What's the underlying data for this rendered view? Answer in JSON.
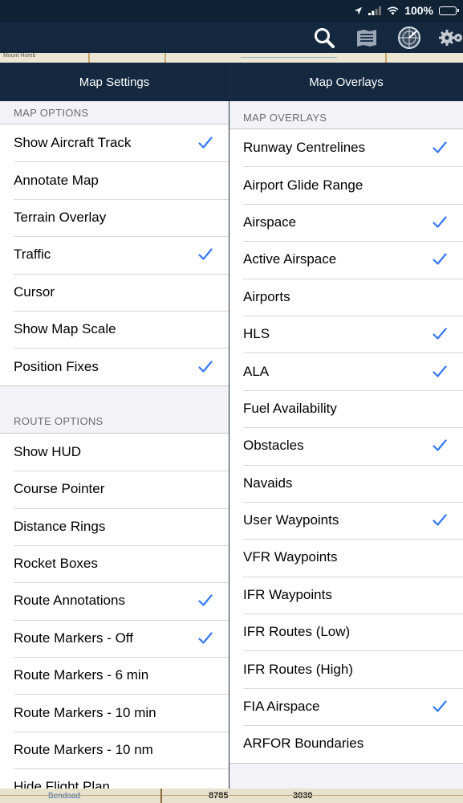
{
  "status": {
    "battery": "100%"
  },
  "toolbar": {
    "icons": [
      "search-icon",
      "list-icon",
      "radar-icon",
      "settings-icon"
    ]
  },
  "map": {
    "place_label": "Mount Horeb",
    "bottom_label_1": "Bendoad",
    "bottom_label_2": "8785",
    "bottom_label_3": "3030"
  },
  "left": {
    "title": "Map Settings",
    "section1": "MAP OPTIONS",
    "items1": [
      {
        "label": "Show Aircraft Track",
        "checked": true
      },
      {
        "label": "Annotate Map",
        "checked": false
      },
      {
        "label": "Terrain Overlay",
        "checked": false
      },
      {
        "label": "Traffic",
        "checked": true
      },
      {
        "label": "Cursor",
        "checked": false
      },
      {
        "label": "Show Map Scale",
        "checked": false
      },
      {
        "label": "Position Fixes",
        "checked": true
      }
    ],
    "section2": "ROUTE OPTIONS",
    "items2": [
      {
        "label": "Show HUD",
        "checked": false
      },
      {
        "label": "Course Pointer",
        "checked": false
      },
      {
        "label": "Distance Rings",
        "checked": false
      },
      {
        "label": "Rocket Boxes",
        "checked": false
      },
      {
        "label": "Route Annotations",
        "checked": true
      },
      {
        "label": "Route Markers - Off",
        "checked": true
      },
      {
        "label": "Route Markers - 6 min",
        "checked": false
      },
      {
        "label": "Route Markers - 10 min",
        "checked": false
      },
      {
        "label": "Route Markers - 10 nm",
        "checked": false
      },
      {
        "label": "Hide Flight Plan",
        "checked": false
      }
    ]
  },
  "right": {
    "title": "Map Overlays",
    "section1": "MAP OVERLAYS",
    "items1": [
      {
        "label": "Runway Centrelines",
        "checked": true
      },
      {
        "label": "Airport Glide Range",
        "checked": false
      },
      {
        "label": "Airspace",
        "checked": true
      },
      {
        "label": "Active Airspace",
        "checked": true
      },
      {
        "label": "Airports",
        "checked": false
      },
      {
        "label": "HLS",
        "checked": true
      },
      {
        "label": "ALA",
        "checked": true
      },
      {
        "label": "Fuel Availability",
        "checked": false
      },
      {
        "label": "Obstacles",
        "checked": true
      },
      {
        "label": "Navaids",
        "checked": false
      },
      {
        "label": "User Waypoints",
        "checked": true
      },
      {
        "label": "VFR Waypoints",
        "checked": false
      },
      {
        "label": "IFR Waypoints",
        "checked": false
      },
      {
        "label": "IFR Routes (Low)",
        "checked": false
      },
      {
        "label": "IFR Routes (High)",
        "checked": false
      },
      {
        "label": "FIA Airspace",
        "checked": true
      },
      {
        "label": "ARFOR Boundaries",
        "checked": false
      }
    ]
  },
  "colors": {
    "accent": "#3478f6",
    "header_bg": "#142940"
  }
}
